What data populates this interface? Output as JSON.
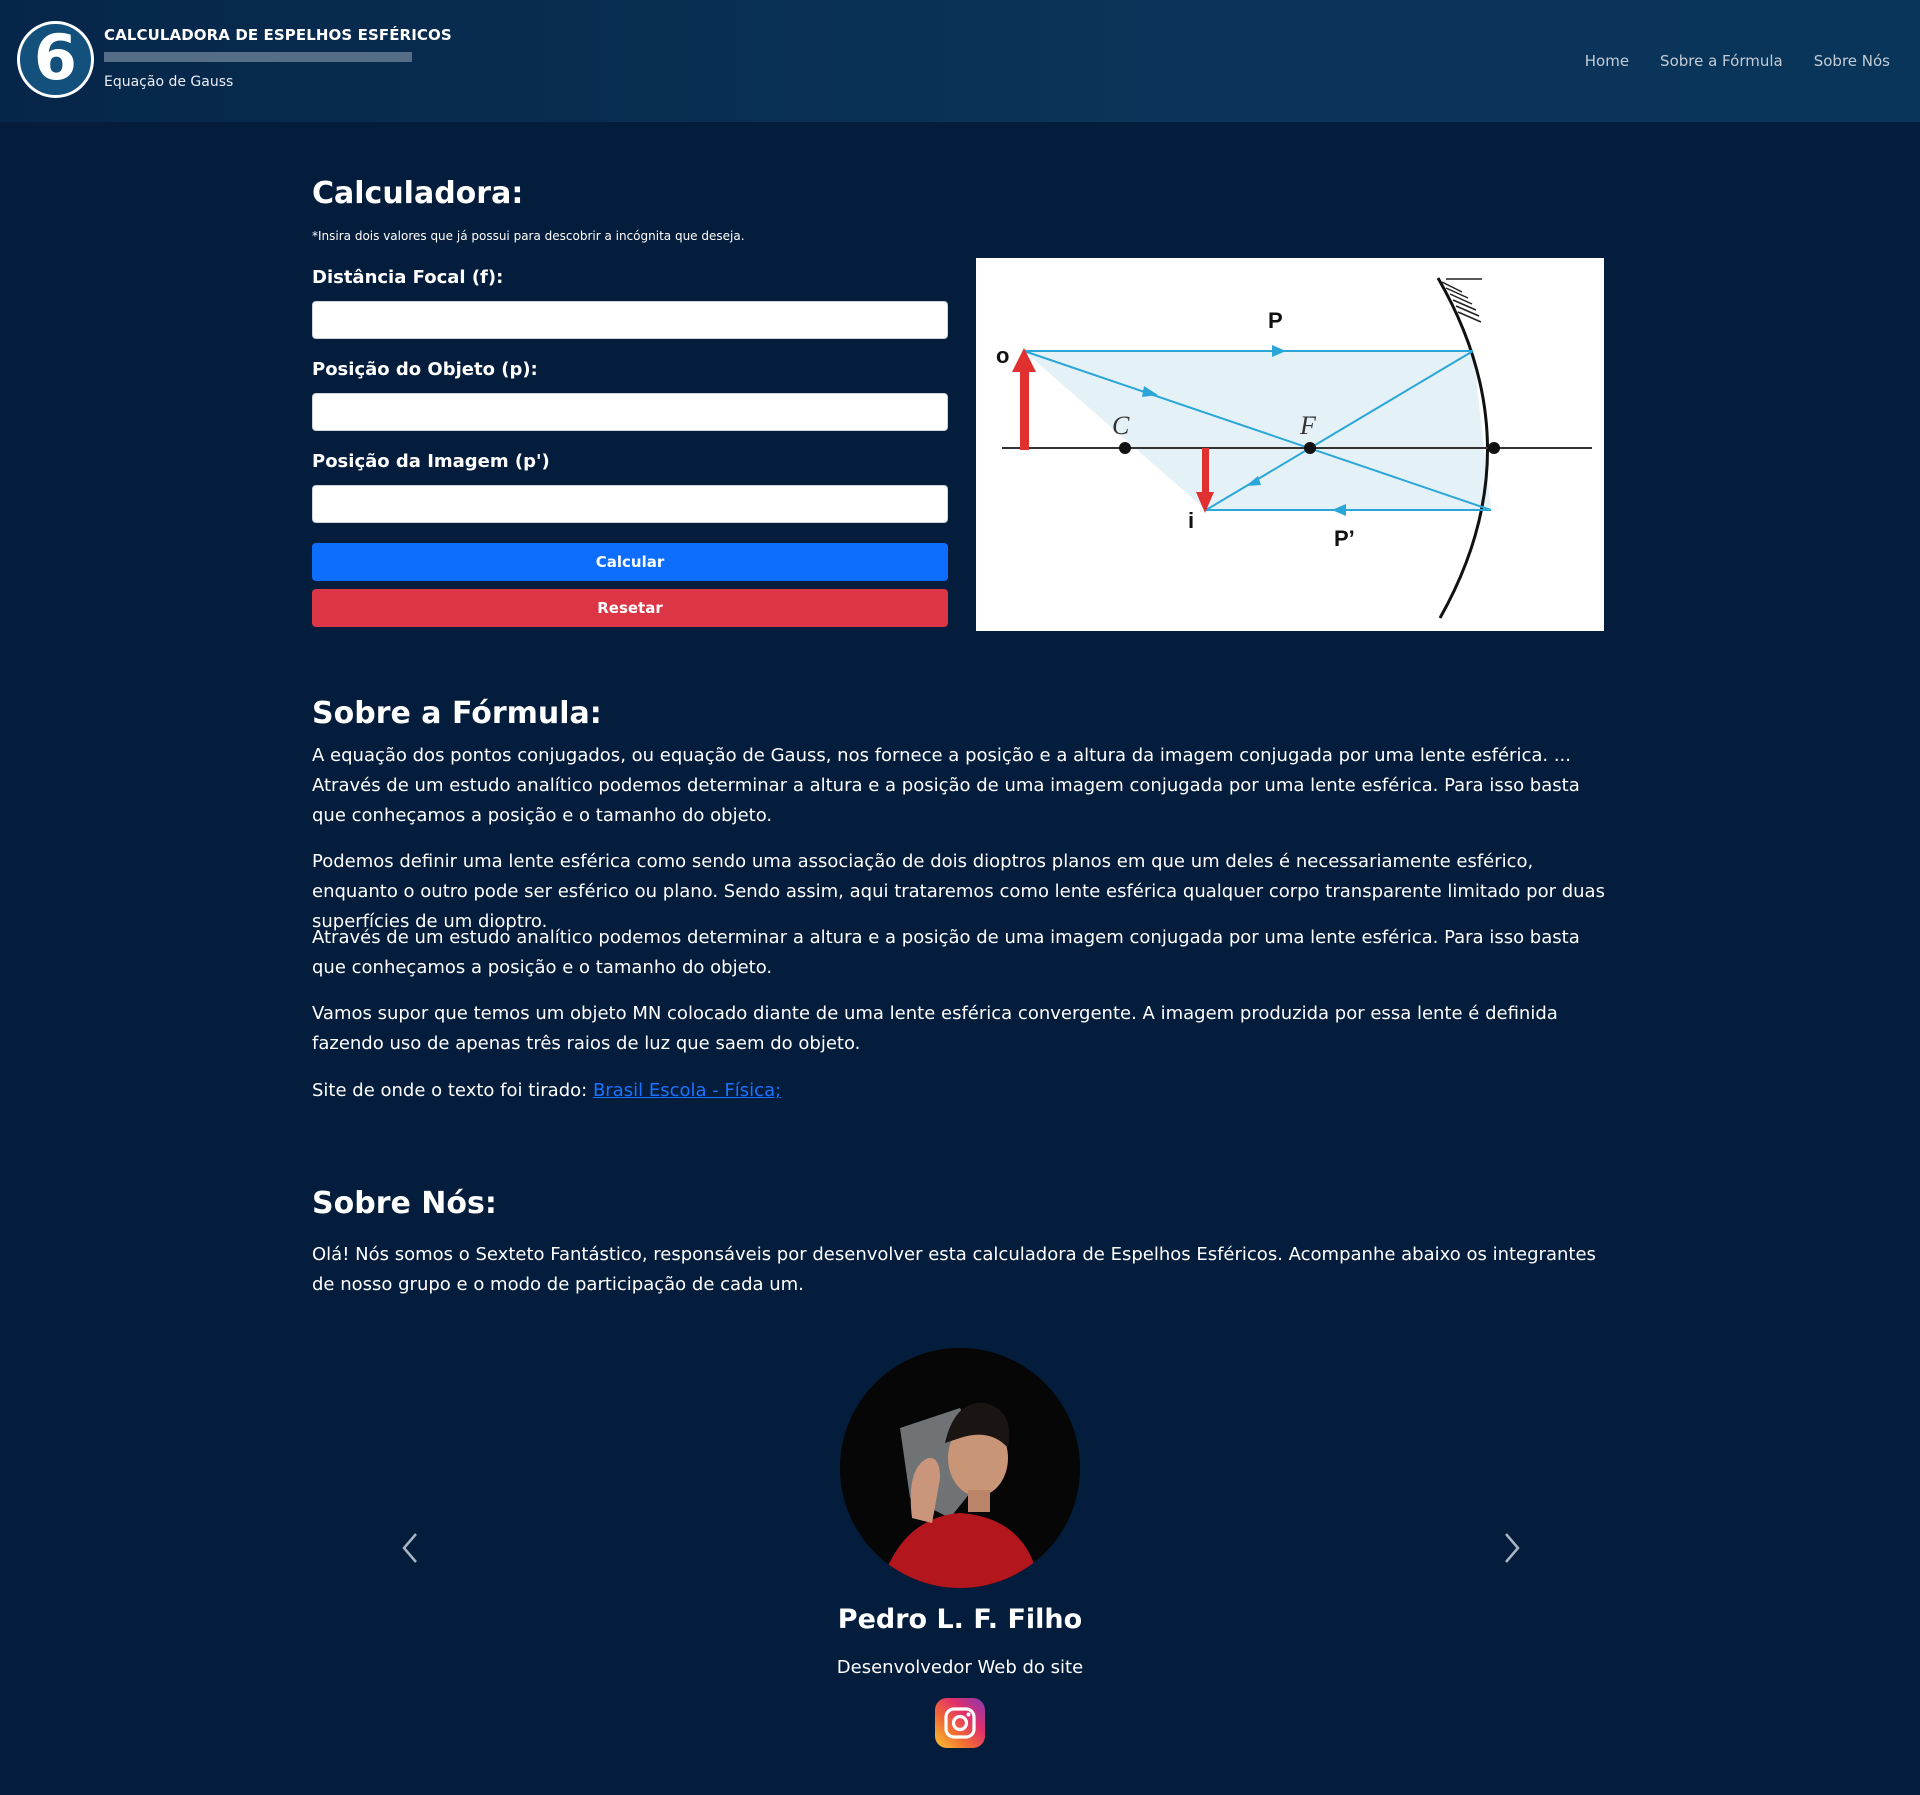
{
  "header": {
    "logo_glyph": "6",
    "title": "CALCULADORA DE ESPELHOS ESFÉRICOS",
    "subtitle": "Equação de Gauss",
    "nav": [
      "Home",
      "Sobre a Fórmula",
      "Sobre Nós"
    ]
  },
  "calculator": {
    "title": "Calculadora:",
    "note": "*Insira dois valores que já possui para descobrir a incógnita que deseja.",
    "fields": [
      {
        "label": "Distância Focal (f):",
        "value": ""
      },
      {
        "label": "Posição do Objeto (p):",
        "value": ""
      },
      {
        "label": "Posição da Imagem (p')",
        "value": ""
      }
    ],
    "calc_button": "Calcular",
    "reset_button": "Resetar",
    "diagram_labels": {
      "object": "o",
      "image": "i",
      "p": "P",
      "p_prime": "P’",
      "center": "C",
      "focus": "F"
    }
  },
  "formula": {
    "title": "Sobre a Fórmula:",
    "paragraphs": [
      "A equação dos pontos conjugados, ou equação de Gauss, nos fornece a posição e a altura da imagem conjugada por uma lente esférica. ... Através de um estudo analítico podemos determinar a altura e a posição de uma imagem conjugada por uma lente esférica. Para isso basta que conheçamos a posição e o tamanho do objeto.",
      "Podemos definir uma lente esférica como sendo uma associação de dois dioptros planos em que um deles é necessariamente esférico, enquanto o outro pode ser esférico ou plano. Sendo assim, aqui trataremos como lente esférica qualquer corpo transparente limitado por duas superfícies de um dioptro.",
      "Através de um estudo analítico podemos determinar a altura e a posição de uma imagem conjugada por uma lente esférica. Para isso basta que conheçamos a posição e o tamanho do objeto.",
      "Vamos supor que temos um objeto MN colocado diante de uma lente esférica convergente. A imagem produzida por essa lente é definida fazendo uso de apenas três raios de luz que saem do objeto."
    ],
    "source_prefix": "Site de onde o texto foi tirado: ",
    "source_link": "Brasil Escola - Física;"
  },
  "about": {
    "title": "Sobre Nós:",
    "intro": "Olá! Nós somos o Sexteto Fantástico, responsáveis por desenvolver esta calculadora de Espelhos Esféricos. Acompanhe abaixo os integrantes de nosso grupo e o modo de participação de cada um.",
    "member": {
      "name": "Pedro L. F. Filho",
      "role": "Desenvolvedor Web do site",
      "social_icon": "instagram-icon"
    }
  },
  "colors": {
    "background": "#051d3c",
    "header": "#0a3459",
    "primary": "#0d6efd",
    "danger": "#dc3545",
    "link": "#1a73ff"
  }
}
